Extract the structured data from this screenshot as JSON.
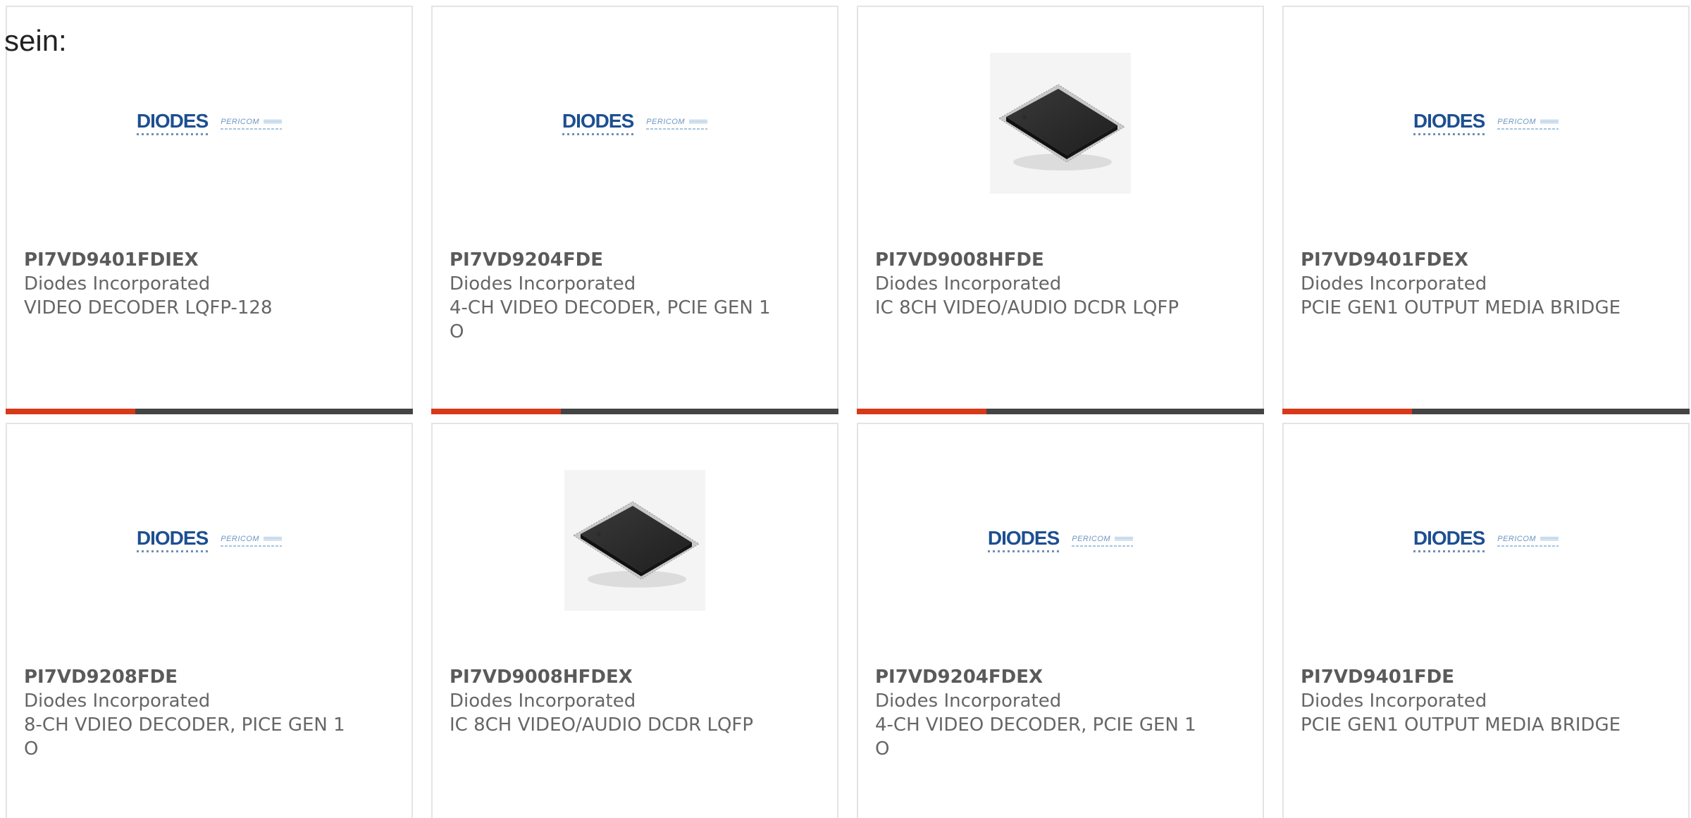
{
  "intro_text": "sein:",
  "colors": {
    "accent": "#d8391a",
    "bar": "#444444",
    "logo_primary": "#1d4f91",
    "logo_secondary": "#6d96c4"
  },
  "logo": {
    "brand": "DIODES",
    "sub_brand": "PERICOM"
  },
  "products": [
    {
      "part": "PI7VD9401FDIEX",
      "manufacturer": "Diodes Incorporated",
      "description": "VIDEO DECODER LQFP-128",
      "image": "diodes-logo"
    },
    {
      "part": "PI7VD9204FDE",
      "manufacturer": "Diodes Incorporated",
      "description": "4-CH VIDEO DECODER, PCIE GEN 1 O",
      "image": "diodes-logo"
    },
    {
      "part": "PI7VD9008HFDE",
      "manufacturer": "Diodes Incorporated",
      "description": "IC 8CH VIDEO/AUDIO DCDR LQFP",
      "image": "lqfp-chip"
    },
    {
      "part": "PI7VD9401FDEX",
      "manufacturer": "Diodes Incorporated",
      "description": "PCIE GEN1 OUTPUT MEDIA BRIDGE",
      "image": "diodes-logo"
    },
    {
      "part": "PI7VD9208FDE",
      "manufacturer": "Diodes Incorporated",
      "description": "8-CH VDIEO DECODER, PICE GEN 1 O",
      "image": "diodes-logo"
    },
    {
      "part": "PI7VD9008HFDEX",
      "manufacturer": "Diodes Incorporated",
      "description": "IC 8CH VIDEO/AUDIO DCDR LQFP",
      "image": "lqfp-chip"
    },
    {
      "part": "PI7VD9204FDEX",
      "manufacturer": "Diodes Incorporated",
      "description": "4-CH VIDEO DECODER, PCIE GEN 1 O",
      "image": "diodes-logo"
    },
    {
      "part": "PI7VD9401FDE",
      "manufacturer": "Diodes Incorporated",
      "description": "PCIE GEN1 OUTPUT MEDIA BRIDGE",
      "image": "diodes-logo"
    }
  ]
}
